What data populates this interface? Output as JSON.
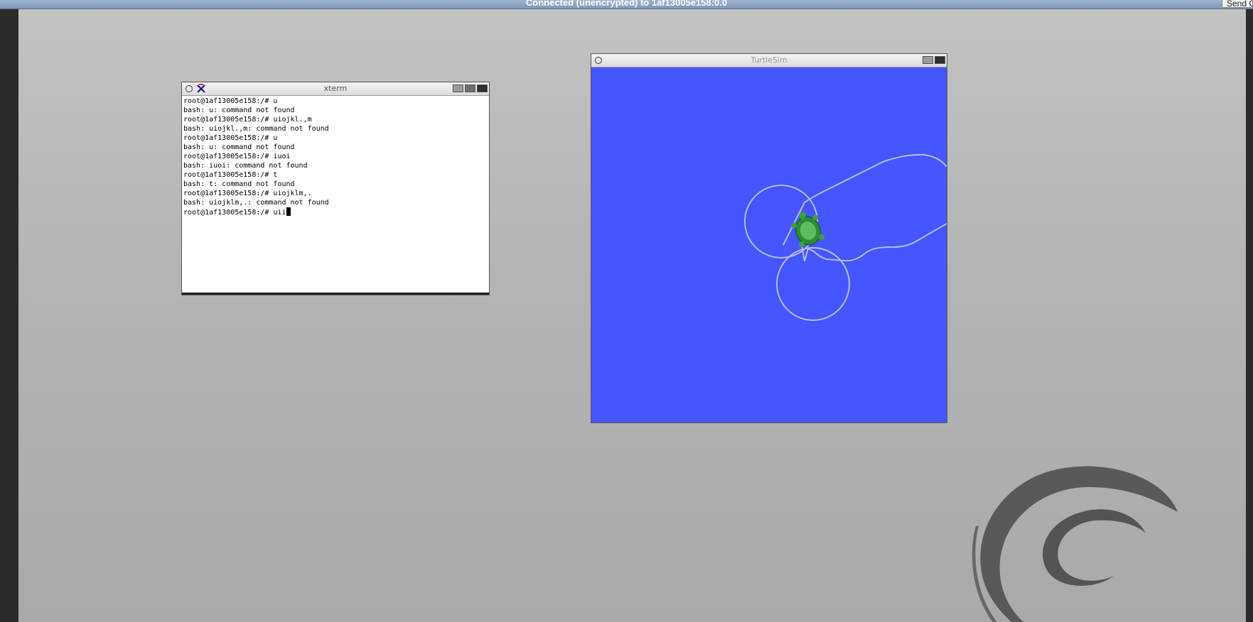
{
  "vnc": {
    "title": "Connected (unencrypted) to 1af13005e158:0.0",
    "send_button_label": "Send CtrlAltDel"
  },
  "xterm": {
    "title": "xterm",
    "lines": [
      "root@1af13005e158:/# u",
      "bash: u: command not found",
      "root@1af13005e158:/# uiojkl.,m",
      "bash: uiojkl.,m: command not found",
      "root@1af13005e158:/# u",
      "bash: u: command not found",
      "root@1af13005e158:/# iuoi",
      "bash: iuoi: command not found",
      "root@1af13005e158:/# t",
      "bash: t: command not found",
      "root@1af13005e158:/# uiojklm,.",
      "bash: uiojklm,.: command not found"
    ],
    "current_line": "root@1af13005e158:/# uii"
  },
  "turtlesim": {
    "title": "TurtleSim",
    "background_color": "#4556ff",
    "pen_color": "#b3b8ff"
  },
  "icons": {
    "window_menu": "debian-swirl-icon",
    "xterm_app": "x-logo-icon",
    "minimize": "minimize-icon",
    "maximize": "maximize-icon",
    "close": "close-icon",
    "turtle": "turtle-icon",
    "wallpaper": "debian-swirl-logo"
  }
}
